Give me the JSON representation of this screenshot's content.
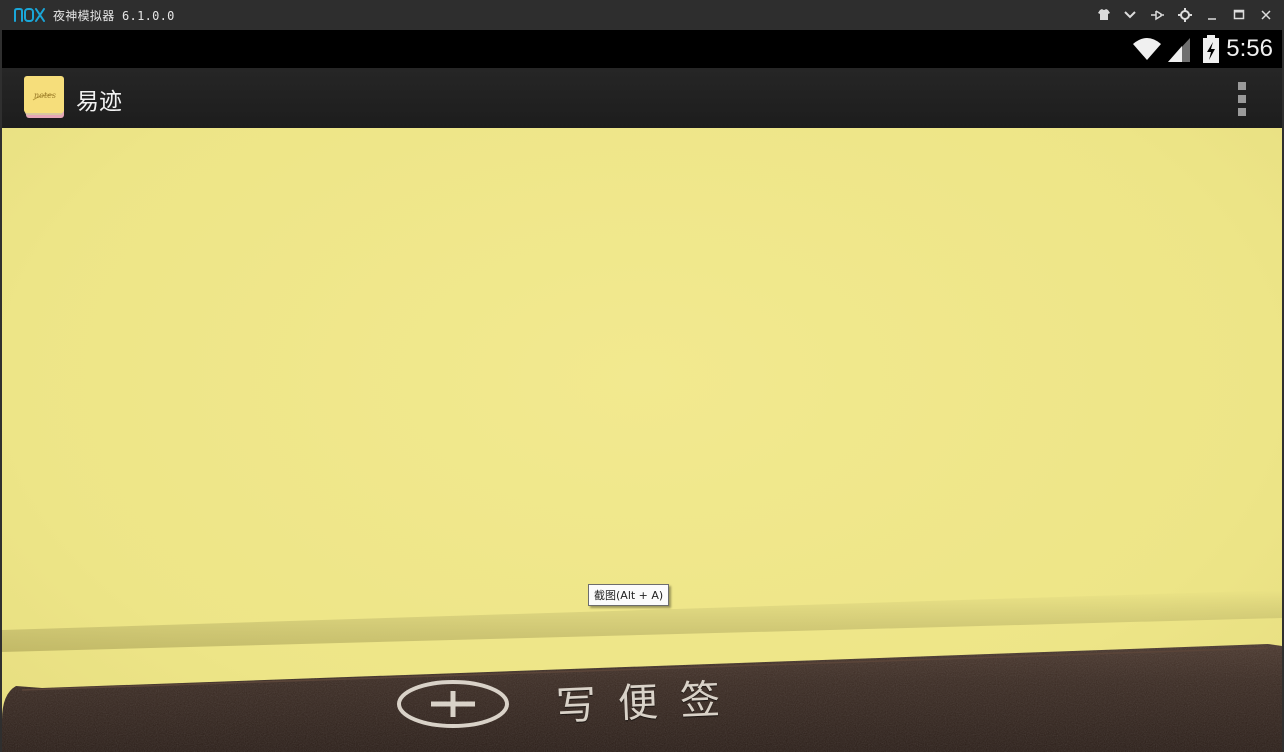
{
  "window": {
    "title": "夜神模拟器 6.1.0.0",
    "logo_icon": "nox-logo",
    "controls": [
      "shirt-icon",
      "chevron-down-icon",
      "pin-icon",
      "gear-icon",
      "minimize-icon",
      "maximize-icon",
      "close-icon"
    ],
    "accent_color": "#1aa6d8"
  },
  "status_bar": {
    "time": "5:56",
    "icons": [
      "wifi-icon",
      "signal-icon",
      "battery-icon"
    ]
  },
  "action_bar": {
    "app_title": "易迹",
    "app_icon": "notes-app-icon",
    "menu_icon": "overflow-menu-icon"
  },
  "main": {
    "background_color": "#efe68b",
    "tooltip": "截图(Alt + A)",
    "write_note_label": "写便签",
    "write_note_icon": "plus-circle-icon",
    "leather_color": "#3a2a22"
  }
}
